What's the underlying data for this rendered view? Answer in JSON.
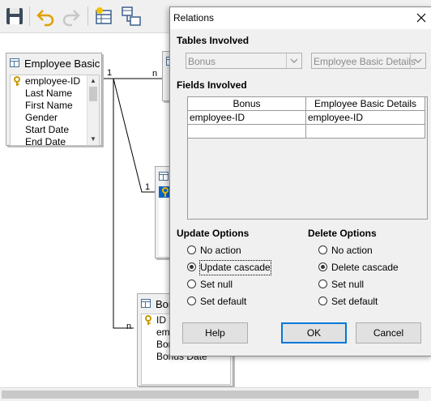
{
  "toolbar": {
    "buttons": [
      {
        "icon": "save-icon"
      },
      {
        "icon": "undo-icon"
      },
      {
        "icon": "redo-icon"
      },
      {
        "icon": "add-table-icon"
      },
      {
        "icon": "new-relation-icon"
      }
    ]
  },
  "canvas": {
    "tables": [
      {
        "title": "Employee Basic D",
        "fields": [
          "employee-ID",
          "Last Name",
          "First Name",
          "Gender",
          "Start Date",
          "End Date"
        ],
        "key_field": "employee-ID"
      },
      {
        "title": "Bonu",
        "fields": [
          "ID",
          "emp",
          "Bon",
          "Bonus Date"
        ],
        "key_field": "ID"
      }
    ],
    "relations": [
      {
        "from_label": "1",
        "to_label": "n"
      },
      {
        "from_label": "1",
        "to_label": ""
      },
      {
        "from_label": "",
        "to_label": "n"
      }
    ]
  },
  "dialog": {
    "title": "Relations",
    "tables_involved_label": "Tables Involved",
    "table_left": "Bonus",
    "table_right": "Employee Basic Details",
    "fields_involved_label": "Fields Involved",
    "grid": {
      "headers": [
        "Bonus",
        "Employee Basic Details"
      ],
      "rows": [
        [
          "employee-ID",
          "employee-ID"
        ],
        [
          "",
          ""
        ]
      ]
    },
    "update_options": {
      "label": "Update Options",
      "options": [
        "No action",
        "Update cascade",
        "Set null",
        "Set default"
      ],
      "selected": "Update cascade"
    },
    "delete_options": {
      "label": "Delete Options",
      "options": [
        "No action",
        "Delete cascade",
        "Set null",
        "Set default"
      ],
      "selected": "Delete cascade"
    },
    "buttons": {
      "help": "Help",
      "ok": "OK",
      "cancel": "Cancel"
    }
  }
}
